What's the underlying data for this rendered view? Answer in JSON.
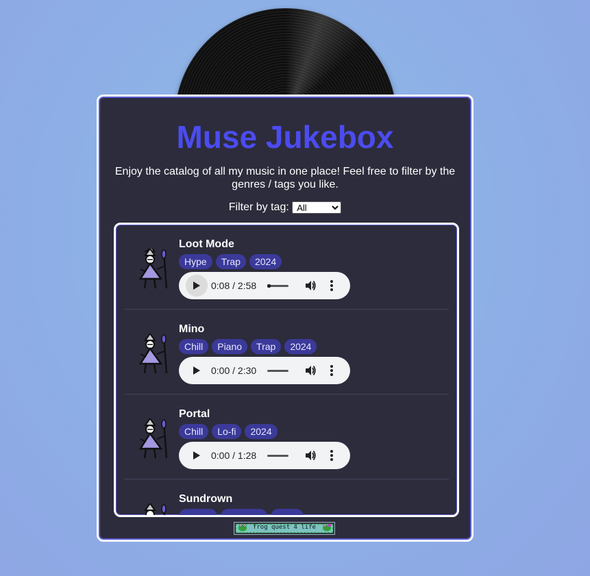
{
  "app": {
    "title": "Muse Jukebox",
    "description": "Enjoy the catalog of all my music in one place! Feel free to filter by the genres / tags you like."
  },
  "filter": {
    "label": "Filter by tag:",
    "selected": "All",
    "options": [
      "All"
    ]
  },
  "songs": [
    {
      "title": "Loot Mode",
      "tags": [
        "Hype",
        "Trap",
        "2024"
      ],
      "time": "0:08 / 2:58",
      "progress": 0.045
    },
    {
      "title": "Mino",
      "tags": [
        "Chill",
        "Piano",
        "Trap",
        "2024"
      ],
      "time": "0:00 / 2:30",
      "progress": 0
    },
    {
      "title": "Portal",
      "tags": [
        "Chill",
        "Lo-fi",
        "2024"
      ],
      "time": "0:00 / 1:28",
      "progress": 0
    },
    {
      "title": "Sundrown",
      "tags": [
        "",
        "",
        ""
      ],
      "time": "",
      "progress": 0
    }
  ],
  "footer": {
    "badge_text": "frog quest 4 life"
  },
  "colors": {
    "title": "#4b4cf0",
    "panel": "#2d2c3c",
    "tag": "#3b3a9a"
  }
}
